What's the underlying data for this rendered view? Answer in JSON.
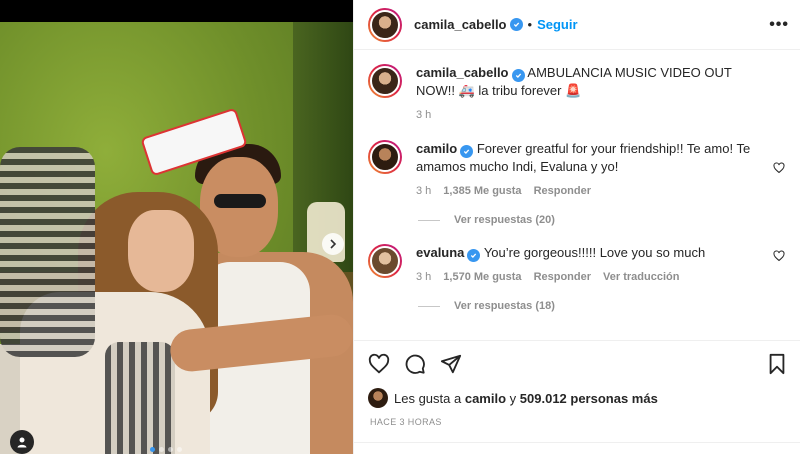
{
  "post": {
    "author": "camila_cabello",
    "follow_label": "Seguir",
    "dot": "•",
    "more_label": "•••"
  },
  "caption": {
    "username": "camila_cabello",
    "text": "AMBULANCIA MUSIC VIDEO OUT NOW!! 🚑 la tribu forever 🚨",
    "time": "3 h"
  },
  "comments": [
    {
      "username": "camilo",
      "text": "Forever greatful for your friendship!! Te amo! Te amamos mucho Indi, Evaluna y yo!",
      "time": "3 h",
      "likes": "1,385 Me gusta",
      "reply_label": "Responder",
      "translate_label": "",
      "view_replies": "Ver respuestas (20)"
    },
    {
      "username": "evaluna",
      "text": "You’re gorgeous!!!!! Love you so much",
      "time": "3 h",
      "likes": "1,570 Me gusta",
      "reply_label": "Responder",
      "translate_label": "Ver traducción",
      "view_replies": "Ver respuestas (18)"
    }
  ],
  "likes_summary": {
    "prefix": "Les gusta a",
    "user": "camilo",
    "conj": "y",
    "count": "509.012 personas más"
  },
  "time_ago": "HACE 3 HORAS",
  "carousel": {
    "count": 4,
    "active_index": 0
  },
  "colors": {
    "verified": "#3897f0",
    "follow": "#0095f6",
    "muted": "#8e8e8e"
  },
  "icons": [
    "verified-icon",
    "heart-icon",
    "comment-icon",
    "share-icon",
    "bookmark-icon",
    "more-icon",
    "chevron-right-icon",
    "user-tag-icon"
  ]
}
